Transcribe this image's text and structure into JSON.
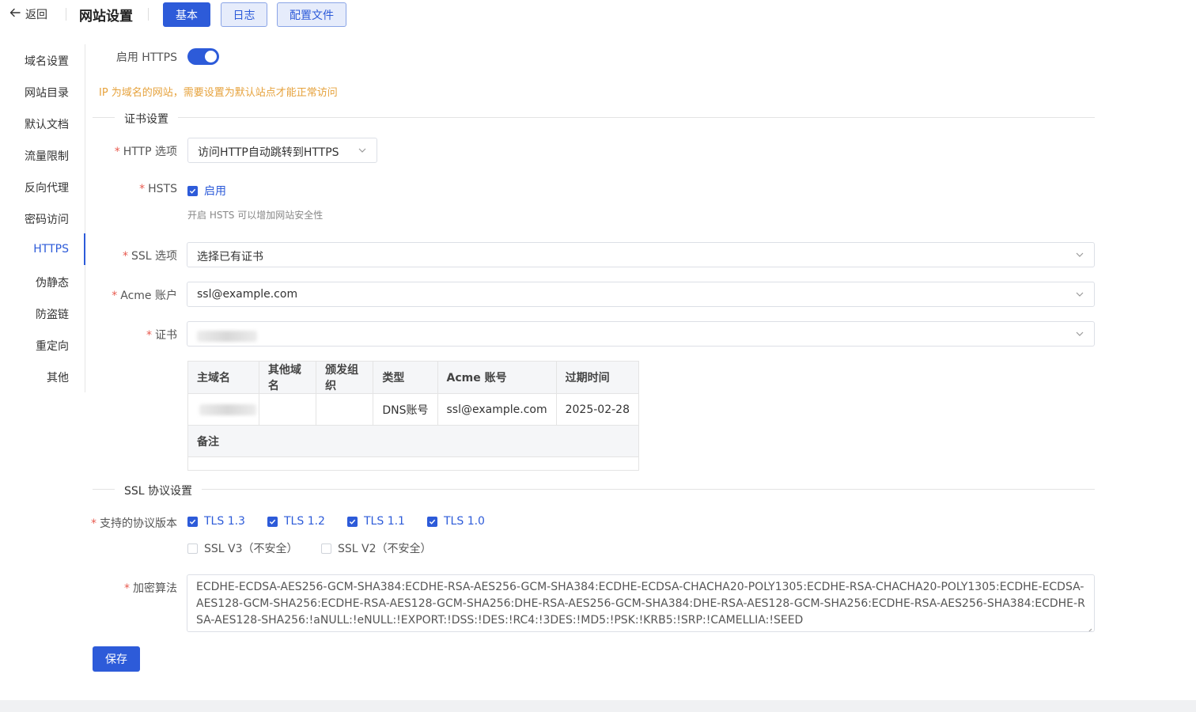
{
  "header": {
    "back_label": "返回",
    "title": "网站设置",
    "tabs": [
      {
        "label": "基本"
      },
      {
        "label": "日志"
      },
      {
        "label": "配置文件"
      }
    ]
  },
  "sidebar": {
    "items": [
      {
        "label": "域名设置"
      },
      {
        "label": "网站目录"
      },
      {
        "label": "默认文档"
      },
      {
        "label": "流量限制"
      },
      {
        "label": "反向代理"
      },
      {
        "label": "密码访问"
      },
      {
        "label": "HTTPS"
      },
      {
        "label": "伪静态"
      },
      {
        "label": "防盗链"
      },
      {
        "label": "重定向"
      },
      {
        "label": "其他"
      }
    ],
    "active": "HTTPS"
  },
  "https": {
    "enable_label": "启用 HTTPS",
    "enabled": true,
    "warning": "IP 为域名的网站，需要设置为默认站点才能正常访问"
  },
  "cert_section": {
    "title": "证书设置",
    "http_option": {
      "label": "HTTP 选项",
      "value": "访问HTTP自动跳转到HTTPS"
    },
    "hsts": {
      "label": "HSTS",
      "checkbox_label": "启用",
      "checked": true,
      "hint": "开启 HSTS 可以增加网站安全性"
    },
    "ssl_option": {
      "label": "SSL 选项",
      "value": "选择已有证书"
    },
    "acme_account": {
      "label": "Acme 账户",
      "value": "ssl@example.com"
    },
    "certificate": {
      "label": "证书"
    }
  },
  "cert_table": {
    "headers": [
      "主域名",
      "其他域名",
      "颁发组织",
      "类型",
      "Acme 账号",
      "过期时间"
    ],
    "row": {
      "primary_domain": "",
      "other_domains": "",
      "issuer": "",
      "type": "DNS账号",
      "acme_account": "ssl@example.com",
      "expires": "2025-02-28"
    },
    "remark_label": "备注"
  },
  "ssl_section": {
    "title": "SSL 协议设置",
    "protocols_label": "支持的协议版本",
    "protocols": [
      {
        "label": "TLS 1.3",
        "checked": true
      },
      {
        "label": "TLS 1.2",
        "checked": true
      },
      {
        "label": "TLS 1.1",
        "checked": true
      },
      {
        "label": "TLS 1.0",
        "checked": true
      },
      {
        "label": "SSL V3（不安全）",
        "checked": false
      },
      {
        "label": "SSL V2（不安全）",
        "checked": false
      }
    ],
    "cipher_label": "加密算法",
    "cipher_value": "ECDHE-ECDSA-AES256-GCM-SHA384:ECDHE-RSA-AES256-GCM-SHA384:ECDHE-ECDSA-CHACHA20-POLY1305:ECDHE-RSA-CHACHA20-POLY1305:ECDHE-ECDSA-AES128-GCM-SHA256:ECDHE-RSA-AES128-GCM-SHA256:DHE-RSA-AES256-GCM-SHA384:DHE-RSA-AES128-GCM-SHA256:ECDHE-RSA-AES256-SHA384:ECDHE-RSA-AES128-SHA256:!aNULL:!eNULL:!EXPORT:!DSS:!DES:!RC4:!3DES:!MD5:!PSK:!KRB5:!SRP:!CAMELLIA:!SEED"
  },
  "save_label": "保存",
  "colors": {
    "primary": "#2d5bd9",
    "warning": "#e6a23c",
    "required": "#e85a4f"
  }
}
